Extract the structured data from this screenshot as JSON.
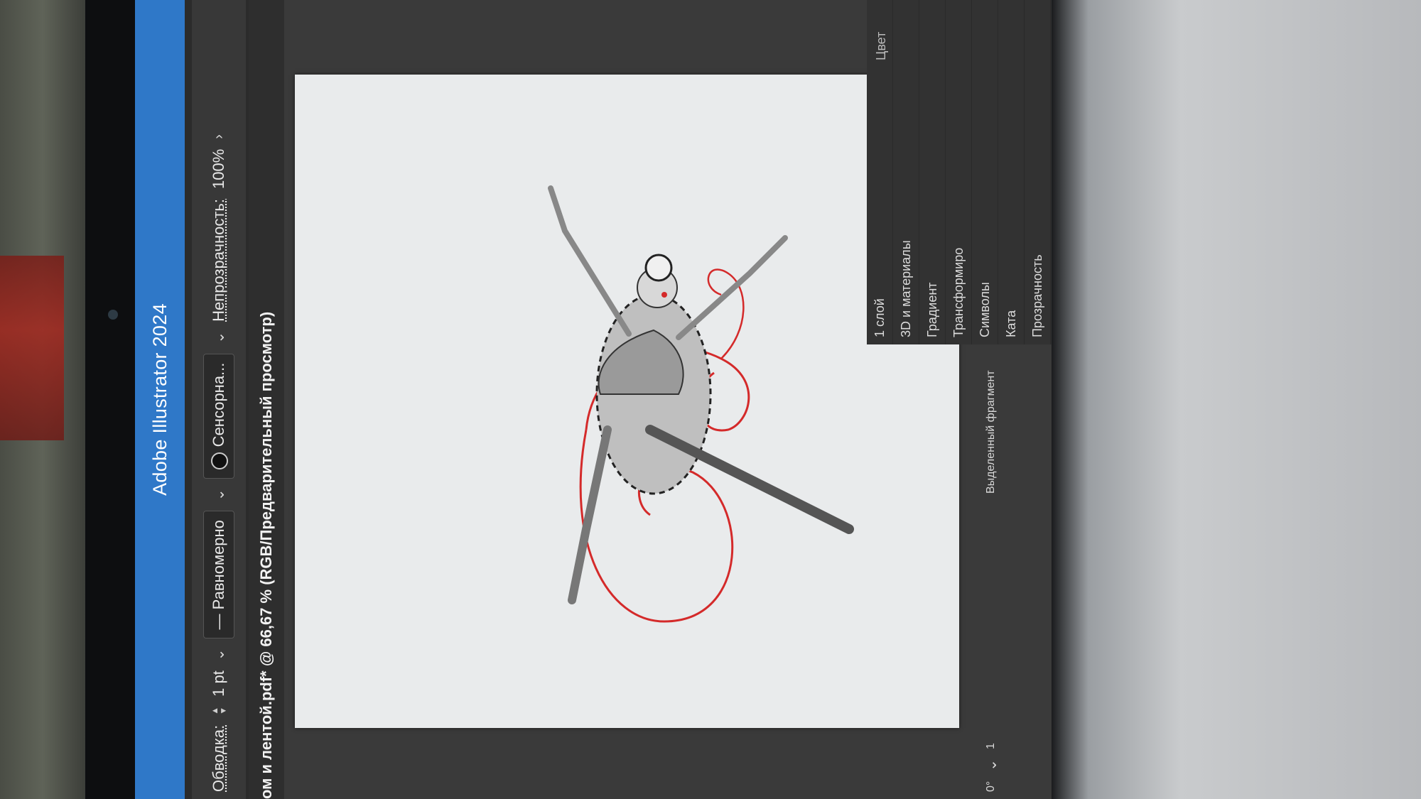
{
  "app": {
    "title": "Adobe Illustrator 2024",
    "document_tab": "ом и лентой.pdf* @ 66,67 % (RGB/Предварительный просмотр)"
  },
  "control_bar": {
    "stroke_label": "Обводка:",
    "stroke_value": "1 pt",
    "variable_width": "Равномерно",
    "brush": "Сенсорна...",
    "opacity_label": "Непрозрачность:",
    "opacity_value": "100%"
  },
  "status_bar": {
    "rotation": "0°",
    "artboard_number": "1",
    "selection_tool": "Выделенный фрагмент"
  },
  "panels": {
    "color_tab": "Цвет",
    "layers_count": "1 слой",
    "items": [
      "3D и материалы",
      "Градиент",
      "Трансформиро",
      "Символы",
      "Ката",
      "Прозрачность"
    ]
  },
  "colors": {
    "title_bar": "#2f78c8",
    "ribbon": "#d42a2a"
  }
}
